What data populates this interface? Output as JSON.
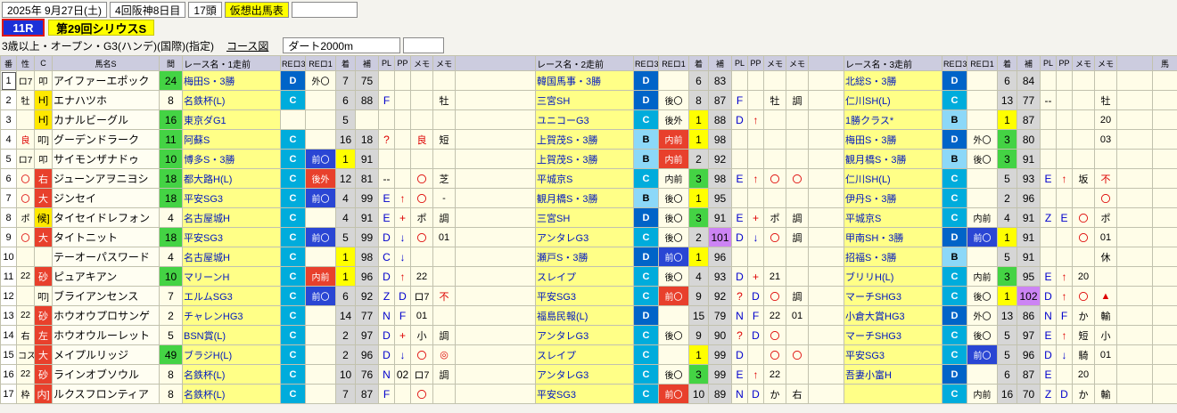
{
  "app": {
    "date": "2025年 9月27日(土)",
    "meeting": "4回阪神8日目",
    "heads": "17頭",
    "sheet_title": "仮想出馬表",
    "race_no": "11R",
    "race_name": "第29回シリウスS",
    "conditions": "3歳以上・オープン・G3(ハンデ)(国際)(指定)",
    "course_link": "コース図",
    "course": "ダート2000m"
  },
  "colors": {
    "highlight_yellow": "#ffff00",
    "race_cell_yellow": "#ffff87",
    "grade_b": "#8cd8f8",
    "grade_c": "#00acdc",
    "grade_d": "#0064c8",
    "position_red_bg": "#e8402c",
    "position_blue_bg": "#2a46d4",
    "finish_first": "#ffff00",
    "finish_third": "#44d344",
    "figure_gray": "#d6d6d6",
    "figure_purple": "#cc84f4",
    "interval_green": "#44d344",
    "header_bg": "#ccccdf",
    "row_bg": "#fffde8",
    "race_number_bg": "#1c30d8"
  },
  "table": {
    "headers": {
      "num": "番",
      "sex": "性",
      "c": "C",
      "name": "馬名S",
      "interval": "間",
      "blocks": [
        "レース名・1走前",
        "レース名・2走前",
        "レース名・3走前"
      ],
      "sub": [
        "REロ3",
        "REロ1",
        "着",
        "補",
        "PL",
        "PP",
        "メモ",
        "メモ"
      ],
      "cut": "馬"
    },
    "rows": [
      {
        "num": "1",
        "sel": true,
        "sex": "ロ7",
        "mark": "叩",
        "markS": "",
        "name": "アイファーエポック",
        "itv": "24",
        "ihl": true,
        "b": [
          {
            "race": "梅田S・3勝",
            "re3": "D",
            "re1": "外〇",
            "fin": "7",
            "ho": "75",
            "pl": "",
            "pp": "",
            "m1": "",
            "m2": ""
          },
          {
            "race": "韓国馬事・3勝",
            "re3": "D",
            "re1": "",
            "fin": "6",
            "ho": "83",
            "pl": "",
            "pp": "",
            "m1": "",
            "m2": ""
          },
          {
            "race": "北総S・3勝",
            "re3": "D",
            "re1": "",
            "fin": "6",
            "ho": "84",
            "pl": "",
            "pp": "",
            "m1": "",
            "m2": ""
          }
        ]
      },
      {
        "num": "2",
        "sex": "牡",
        "mark": "H]",
        "markS": "y",
        "name": "エナハツホ",
        "itv": "8",
        "ihl": false,
        "b": [
          {
            "race": "名鉄杯(L)",
            "re3": "C",
            "re1": "",
            "fin": "6",
            "ho": "88",
            "pl": "F",
            "pp": "",
            "m1": "",
            "m2": "牡"
          },
          {
            "race": "三宮SH",
            "re3": "D",
            "re1": "後〇",
            "fin": "8",
            "ho": "87",
            "pl": "F",
            "pp": "",
            "m1": "牡",
            "m2": "調"
          },
          {
            "race": "仁川SH(L)",
            "re3": "C",
            "re1": "",
            "fin": "13",
            "ho": "77",
            "pl": "--",
            "pp": "",
            "m1": "",
            "m2": "牡"
          }
        ]
      },
      {
        "num": "3",
        "sex": "",
        "mark": "H]",
        "markS": "y",
        "name": "カナルビーグル",
        "itv": "16",
        "ihl": true,
        "b": [
          {
            "race": "東京ダG1",
            "re3": "",
            "re1": "",
            "fin": "5",
            "ho": "",
            "pl": "",
            "pp": "",
            "m1": "",
            "m2": ""
          },
          {
            "race": "ユニコーG3",
            "re3": "C",
            "re1": "後外",
            "fin": "1",
            "ho": "88",
            "pl": "D",
            "pp": "↑",
            "m1": "",
            "m2": ""
          },
          {
            "race": "1勝クラス*",
            "re3": "B",
            "re1": "",
            "fin": "1",
            "ho": "87",
            "pl": "",
            "pp": "",
            "m1": "",
            "m2": "20"
          }
        ]
      },
      {
        "num": "4",
        "sex": "良",
        "mark": "叩]",
        "markS": "",
        "name": "グーデンドラーク",
        "itv": "11",
        "ihl": true,
        "b": [
          {
            "race": "阿蘇S",
            "re3": "C",
            "re1": "",
            "fin": "16",
            "ho": "18",
            "pl": "?",
            "pp": "",
            "m1": "良",
            "m2": "短"
          },
          {
            "race": "上賀茂S・3勝",
            "re3": "B",
            "re1": [
              "内前",
              "bgR"
            ],
            "fin": "1",
            "ho": "98",
            "pl": "",
            "pp": "",
            "m1": "",
            "m2": ""
          },
          {
            "race": "梅田S・3勝",
            "re3": "D",
            "re1": "外〇",
            "fin": "3",
            "ho": "80",
            "pl": "",
            "pp": "",
            "m1": "",
            "m2": "03"
          }
        ]
      },
      {
        "num": "5",
        "sex": "ロ7",
        "mark": "叩",
        "markS": "",
        "name": "サイモンザナドゥ",
        "itv": "10",
        "ihl": true,
        "b": [
          {
            "race": "博多S・3勝",
            "re3": "C",
            "re1": [
              "前〇",
              "bgB"
            ],
            "fin": "1",
            "ho": "91",
            "pl": "",
            "pp": "",
            "m1": "",
            "m2": ""
          },
          {
            "race": "上賀茂S・3勝",
            "re3": "B",
            "re1": [
              "内前",
              "bgR"
            ],
            "fin": "2",
            "ho": "92",
            "pl": "",
            "pp": "",
            "m1": "",
            "m2": ""
          },
          {
            "race": "観月橋S・3勝",
            "re3": "B",
            "re1": "後〇",
            "fin": "3",
            "ho": "91",
            "pl": "",
            "pp": "",
            "m1": "",
            "m2": ""
          }
        ]
      },
      {
        "num": "6",
        "sex": "〇",
        "mark": "右",
        "markS": "r",
        "name": "ジューンアヲニヨシ",
        "itv": "18",
        "ihl": true,
        "b": [
          {
            "race": "都大路H(L)",
            "re3": "C",
            "re1": [
              "後外",
              "bgR"
            ],
            "fin": "12",
            "ho": "81",
            "pl": "--",
            "pp": "",
            "m1": "〇",
            "m2": "芝"
          },
          {
            "race": "平城京S",
            "re3": "C",
            "re1": "内前",
            "fin": "3",
            "ho": "98",
            "pl": "E",
            "pp": "↑",
            "m1": "〇",
            "m2": "〇"
          },
          {
            "race": "仁川SH(L)",
            "re3": "C",
            "re1": "",
            "fin": "5",
            "ho": "93",
            "pl": "E",
            "pp": "↑",
            "m1": "坂",
            "m2": "不"
          }
        ]
      },
      {
        "num": "7",
        "sex": "〇",
        "mark": "大",
        "markS": "r",
        "name": "ジンセイ",
        "itv": "18",
        "ihl": true,
        "b": [
          {
            "race": "平安SG3",
            "re3": "C",
            "re1": [
              "前〇",
              "bgB"
            ],
            "fin": "4",
            "ho": "99",
            "pl": "E",
            "pp": "↑",
            "m1": "〇",
            "m2": "-"
          },
          {
            "race": "観月橋S・3勝",
            "re3": "B",
            "re1": "後〇",
            "fin": "1",
            "ho": "95",
            "pl": "",
            "pp": "",
            "m1": "",
            "m2": ""
          },
          {
            "race": "伊丹S・3勝",
            "re3": "C",
            "re1": "",
            "fin": "2",
            "ho": "96",
            "pl": "",
            "pp": "",
            "m1": "",
            "m2": "〇"
          }
        ]
      },
      {
        "num": "8",
        "sex": "ポ",
        "mark": "候]",
        "markS": "y",
        "name": "タイセイドレフォン",
        "itv": "4",
        "ihl": false,
        "b": [
          {
            "race": "名古屋城H",
            "re3": "C",
            "re1": "",
            "fin": "4",
            "ho": "91",
            "pl": "E",
            "pp": "+",
            "m1": "ポ",
            "m2": "調"
          },
          {
            "race": "三宮SH",
            "re3": "D",
            "re1": "後〇",
            "fin": "3",
            "ho": "91",
            "pl": "E",
            "pp": "+",
            "m1": "ポ",
            "m2": "調"
          },
          {
            "race": "平城京S",
            "re3": "C",
            "re1": "内前",
            "fin": "4",
            "ho": "91",
            "pl": "Z",
            "pp": "E",
            "m1": "〇",
            "m2": "ポ"
          }
        ]
      },
      {
        "num": "9",
        "sex": "〇",
        "mark": "大",
        "markS": "r",
        "name": "タイトニット",
        "itv": "18",
        "ihl": true,
        "b": [
          {
            "race": "平安SG3",
            "re3": "C",
            "re1": [
              "前〇",
              "bgB"
            ],
            "fin": "5",
            "ho": "99",
            "pl": "D",
            "pp": "↓",
            "m1": "〇",
            "m2": "01"
          },
          {
            "race": "アンタレG3",
            "re3": "C",
            "re1": "後〇",
            "fin": "2",
            "ho": "101",
            "pl": "D",
            "pp": "↓",
            "m1": "〇",
            "m2": "調"
          },
          {
            "race": "甲南SH・3勝",
            "re3": "D",
            "re1": [
              "前〇",
              "bgB"
            ],
            "fin": "1",
            "ho": "91",
            "pl": "",
            "pp": "",
            "m1": "〇",
            "m2": "01"
          }
        ]
      },
      {
        "num": "10",
        "sex": "",
        "mark": "",
        "markS": "",
        "name": "テーオーパスワード",
        "itv": "4",
        "ihl": false,
        "b": [
          {
            "race": "名古屋城H",
            "re3": "C",
            "re1": "",
            "fin": "1",
            "ho": "98",
            "pl": "C",
            "pp": "↓",
            "m1": "",
            "m2": ""
          },
          {
            "race": "瀬戸S・3勝",
            "re3": "D",
            "re1": [
              "前〇",
              "bgB"
            ],
            "fin": "1",
            "ho": "96",
            "pl": "",
            "pp": "",
            "m1": "",
            "m2": ""
          },
          {
            "race": "招福S・3勝",
            "re3": "B",
            "re1": "",
            "fin": "5",
            "ho": "91",
            "pl": "",
            "pp": "",
            "m1": "",
            "m2": "休"
          }
        ]
      },
      {
        "num": "11",
        "sex": "22",
        "mark": "砂",
        "markS": "r",
        "name": "ピュアキアン",
        "itv": "10",
        "ihl": true,
        "b": [
          {
            "race": "マリーンH",
            "re3": "C",
            "re1": [
              "内前",
              "bgR"
            ],
            "fin": "1",
            "ho": "96",
            "pl": "D",
            "pp": "↑",
            "m1": "22",
            "m2": ""
          },
          {
            "race": "スレイプ",
            "re3": "C",
            "re1": "後〇",
            "fin": "4",
            "ho": "93",
            "pl": "D",
            "pp": "+",
            "m1": "21",
            "m2": ""
          },
          {
            "race": "ブリリH(L)",
            "re3": "C",
            "re1": "内前",
            "fin": "3",
            "ho": "95",
            "pl": "E",
            "pp": "↑",
            "m1": "20",
            "m2": ""
          }
        ]
      },
      {
        "num": "12",
        "sex": "",
        "mark": "叩]",
        "markS": "",
        "name": "ブライアンセンス",
        "itv": "7",
        "ihl": false,
        "b": [
          {
            "race": "エルムSG3",
            "re3": "C",
            "re1": [
              "前〇",
              "bgB"
            ],
            "fin": "6",
            "ho": "92",
            "pl": "Z",
            "pp": "D",
            "m1": "ロ7",
            "m2": "不"
          },
          {
            "race": "平安SG3",
            "re3": "C",
            "re1": [
              "前〇",
              "bgR"
            ],
            "fin": "9",
            "ho": "92",
            "pl": "?",
            "pp": "D",
            "m1": "〇",
            "m2": "調"
          },
          {
            "race": "マーチSHG3",
            "re3": "C",
            "re1": "後〇",
            "fin": "1",
            "ho": "102",
            "pl": "D",
            "pp": "↑",
            "m1": "〇",
            "m2": "▲"
          }
        ]
      },
      {
        "num": "13",
        "sex": "22",
        "mark": "砂",
        "markS": "r",
        "name": "ホウオウプロサンゲ",
        "itv": "2",
        "ihl": false,
        "b": [
          {
            "race": "チャレンHG3",
            "re3": "C",
            "re1": "",
            "fin": "14",
            "ho": "77",
            "pl": "N",
            "pp": "F",
            "m1": "01",
            "m2": ""
          },
          {
            "race": "福島民報(L)",
            "re3": "D",
            "re1": "",
            "fin": "15",
            "ho": "79",
            "pl": "N",
            "pp": "F",
            "m1": "22",
            "m2": "01"
          },
          {
            "race": "小倉大賞HG3",
            "re3": "D",
            "re1": "外〇",
            "fin": "13",
            "ho": "86",
            "pl": "N",
            "pp": "F",
            "m1": "か",
            "m2": "輸"
          }
        ]
      },
      {
        "num": "14",
        "sex": "右",
        "mark": "左",
        "markS": "r",
        "name": "ホウオウルーレット",
        "itv": "5",
        "ihl": false,
        "b": [
          {
            "race": "BSN賞(L)",
            "re3": "C",
            "re1": "",
            "fin": "2",
            "ho": "97",
            "pl": "D",
            "pp": "+",
            "m1": "小",
            "m2": "調"
          },
          {
            "race": "アンタレG3",
            "re3": "C",
            "re1": "後〇",
            "fin": "9",
            "ho": "90",
            "pl": "?",
            "pp": "D",
            "m1": "〇",
            "m2": ""
          },
          {
            "race": "マーチSHG3",
            "re3": "C",
            "re1": "後〇",
            "fin": "5",
            "ho": "97",
            "pl": "E",
            "pp": "↑",
            "m1": "短",
            "m2": "小"
          }
        ]
      },
      {
        "num": "15",
        "sex": "コス",
        "mark": "大",
        "markS": "r",
        "name": "メイプルリッジ",
        "itv": "49",
        "ihl": true,
        "b": [
          {
            "race": "ブラジH(L)",
            "re3": "C",
            "re1": "",
            "fin": "2",
            "ho": "96",
            "pl": "D",
            "pp": "↓",
            "m1": "〇",
            "m2": "◎"
          },
          {
            "race": "スレイプ",
            "re3": "C",
            "re1": "",
            "fin": "1",
            "ho": "99",
            "pl": "D",
            "pp": "",
            "m1": "〇",
            "m2": "〇"
          },
          {
            "race": "平安SG3",
            "re3": "C",
            "re1": [
              "前〇",
              "bgB"
            ],
            "fin": "5",
            "ho": "96",
            "pl": "D",
            "pp": "↓",
            "m1": "騎",
            "m2": "01"
          }
        ]
      },
      {
        "num": "16",
        "sex": "22",
        "mark": "砂",
        "markS": "r",
        "name": "ラインオブソウル",
        "itv": "8",
        "ihl": false,
        "b": [
          {
            "race": "名鉄杯(L)",
            "re3": "C",
            "re1": "",
            "fin": "10",
            "ho": "76",
            "pl": "N",
            "pp": "02",
            "m1": "ロ7",
            "m2": "調"
          },
          {
            "race": "アンタレG3",
            "re3": "C",
            "re1": "後〇",
            "fin": "3",
            "ho": "99",
            "pl": "E",
            "pp": "↑",
            "m1": "22",
            "m2": ""
          },
          {
            "race": "吾妻小富H",
            "re3": "D",
            "re1": "",
            "fin": "6",
            "ho": "87",
            "pl": "E",
            "pp": "",
            "m1": "20",
            "m2": ""
          }
        ]
      },
      {
        "num": "17",
        "sex": "枠",
        "mark": "内]",
        "markS": "r",
        "name": "ルクスフロンティア",
        "itv": "8",
        "ihl": false,
        "b": [
          {
            "race": "名鉄杯(L)",
            "re3": "C",
            "re1": "",
            "fin": "7",
            "ho": "87",
            "pl": "F",
            "pp": "",
            "m1": "〇",
            "m2": ""
          },
          {
            "race": "平安SG3",
            "re3": "C",
            "re1": [
              "前〇",
              "bgR"
            ],
            "fin": "10",
            "ho": "89",
            "pl": "N",
            "pp": "D",
            "m1": "か",
            "m2": "右"
          },
          {
            "race": "",
            "re3": "C",
            "re1": "内前",
            "fin": "16",
            "ho": "70",
            "pl": "Z",
            "pp": "D",
            "m1": "か",
            "m2": "輸"
          }
        ]
      }
    ]
  }
}
